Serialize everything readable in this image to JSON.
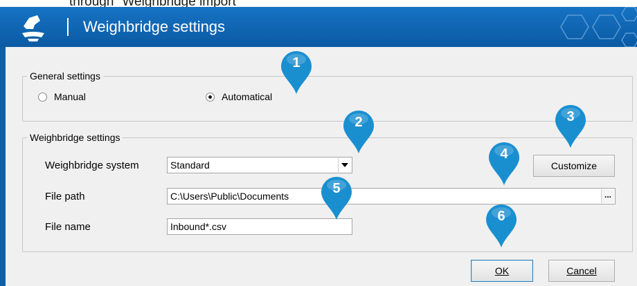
{
  "doc_caption": "through \"Weighbridge import\"",
  "window": {
    "title": "Weighbridge settings"
  },
  "general_settings": {
    "legend": "General settings",
    "options": [
      {
        "label": "Manual",
        "selected": false
      },
      {
        "label": "Automatical",
        "selected": true
      }
    ]
  },
  "weighbridge_settings": {
    "legend": "Weighbridge settings",
    "system_label": "Weighbridge system",
    "system_value": "Standard",
    "customize_label": "Customize",
    "filepath_label": "File path",
    "filepath_value": "C:\\Users\\Public\\Documents",
    "browse_label": "...",
    "filename_label": "File name",
    "filename_value": "Inbound*.csv"
  },
  "footer": {
    "ok_label": "OK",
    "cancel_label": "Cancel"
  },
  "markers": [
    "1",
    "2",
    "3",
    "4",
    "5",
    "6"
  ],
  "colors": {
    "titlebar": "#0b5aa3",
    "marker": "#1a8fd0",
    "dialog_bg": "#f0f0f0"
  },
  "icons": [
    "app-logo-icon",
    "hexagon-decoration-icon",
    "radio-icon",
    "dropdown-arrow-icon",
    "ellipsis-icon",
    "callout-marker-icon"
  ]
}
